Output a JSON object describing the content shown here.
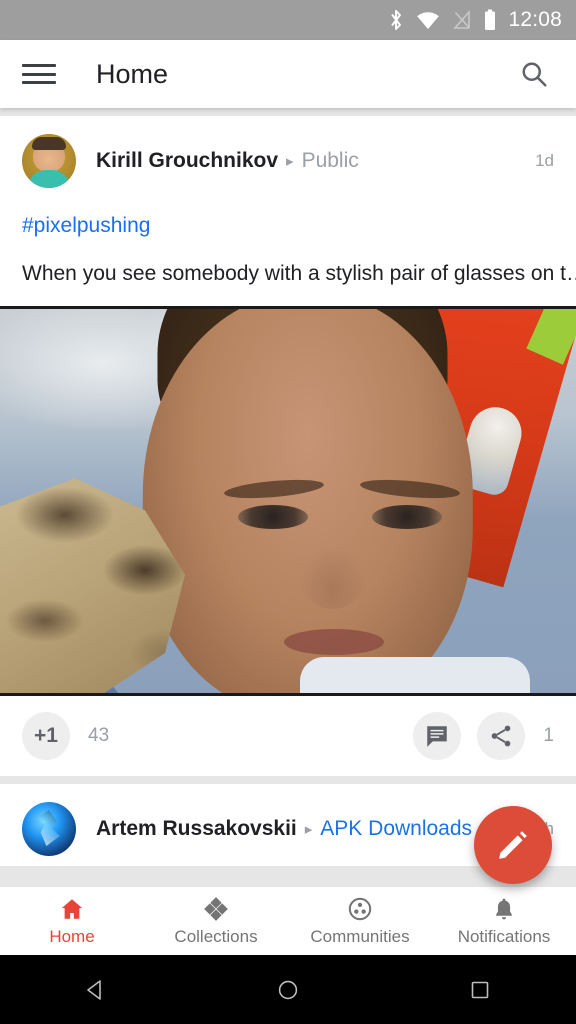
{
  "statusbar": {
    "time": "12:08",
    "icons": [
      "bluetooth-icon",
      "wifi-icon",
      "cellular-signal-off-icon",
      "battery-icon"
    ]
  },
  "appbar": {
    "title": "Home",
    "menu_icon": "hamburger-menu-icon",
    "search_icon": "search-icon"
  },
  "feed": {
    "posts": [
      {
        "author": "Kirill Grouchnikov",
        "separator": "▸",
        "audience": "Public",
        "audience_is_link": false,
        "timestamp": "1d",
        "hashtag": "#pixelpushing",
        "text": "When you see somebody with a stylish pair of glasses on t…",
        "actions": {
          "plus_one_label": "+1",
          "plus_one_count": "43",
          "comment_icon": "comment-icon",
          "share_icon": "share-icon",
          "share_count": "1"
        }
      },
      {
        "author": "Artem Russakovskii",
        "separator": "▸",
        "audience": "APK Downloads",
        "audience_is_link": true,
        "timestamp": "16h"
      }
    ]
  },
  "fab": {
    "icon": "compose-pencil-icon",
    "color": "#dd4b39"
  },
  "bottomnav": {
    "active_color": "#e8443a",
    "inactive_color": "#757575",
    "items": [
      {
        "label": "Home",
        "icon": "home-icon",
        "active": true
      },
      {
        "label": "Collections",
        "icon": "collections-diamonds-icon",
        "active": false
      },
      {
        "label": "Communities",
        "icon": "communities-circle-icon",
        "active": false
      },
      {
        "label": "Notifications",
        "icon": "bell-icon",
        "active": false
      }
    ]
  },
  "androidnav": {
    "back_icon": "back-triangle-icon",
    "home_icon": "home-circle-icon",
    "recents_icon": "recents-square-icon"
  }
}
